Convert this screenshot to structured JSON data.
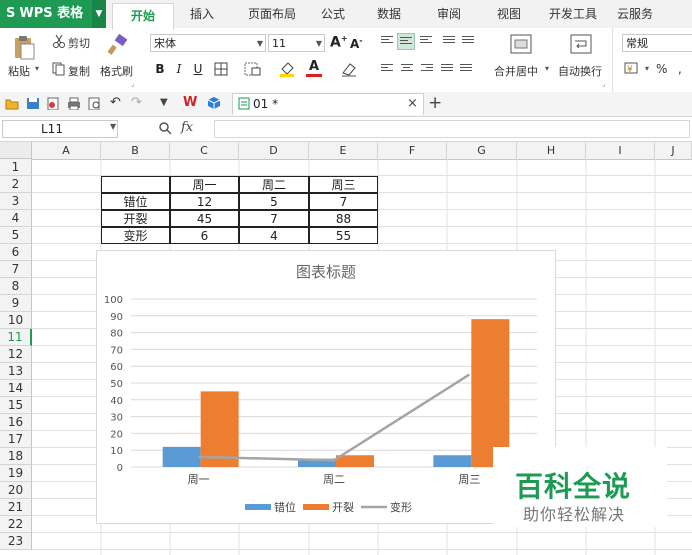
{
  "app": {
    "name": "WPS 表格"
  },
  "menu": {
    "tabs": [
      "开始",
      "插入",
      "页面布局",
      "公式",
      "数据",
      "审阅",
      "视图",
      "开发工具",
      "云服务"
    ],
    "active": "开始"
  },
  "ribbon": {
    "paste": "粘贴",
    "cut": "剪切",
    "copy": "复制",
    "format_painter": "格式刷",
    "font_name": "宋体",
    "font_size": "11",
    "bold": "B",
    "italic": "I",
    "underline": "U",
    "merge_center": "合并居中",
    "wrap_text": "自动换行",
    "number_format": "常规",
    "percent": "%"
  },
  "doc_tab": {
    "name": "01 *"
  },
  "formula_bar": {
    "name_box": "L11",
    "fx": "fx",
    "value": ""
  },
  "sheet": {
    "columns": [
      "A",
      "B",
      "C",
      "D",
      "E",
      "F",
      "G",
      "H",
      "I",
      "J"
    ],
    "rows": [
      "1",
      "2",
      "3",
      "4",
      "5",
      "6",
      "7",
      "8",
      "9",
      "10",
      "11",
      "12",
      "13",
      "14",
      "15",
      "16",
      "17",
      "18",
      "19",
      "20",
      "21",
      "22",
      "23"
    ],
    "selected_row": "11",
    "table": {
      "headers": [
        "",
        "周一",
        "周二",
        "周三"
      ],
      "rows": [
        [
          "错位",
          "12",
          "5",
          "7"
        ],
        [
          "开裂",
          "45",
          "7",
          "88"
        ],
        [
          "变形",
          "6",
          "4",
          "55"
        ]
      ]
    }
  },
  "chart_data": {
    "type": "bar",
    "title": "图表标题",
    "categories": [
      "周一",
      "周二",
      "周三"
    ],
    "series": [
      {
        "name": "错位",
        "type": "bar",
        "values": [
          12,
          5,
          7
        ],
        "color": "#5b9bd5"
      },
      {
        "name": "开裂",
        "type": "bar",
        "values": [
          45,
          7,
          88
        ],
        "color": "#ed7d31"
      },
      {
        "name": "变形",
        "type": "line",
        "values": [
          6,
          4,
          55
        ],
        "color": "#a5a5a5"
      }
    ],
    "ylim": [
      0,
      100
    ],
    "yticks": [
      "0",
      "10",
      "20",
      "30",
      "40",
      "50",
      "60",
      "70",
      "80",
      "90",
      "100"
    ],
    "grid": true,
    "legend": "bottom"
  },
  "watermark": {
    "title": "百科全说",
    "subtitle": "助你轻松解决",
    "color": "#1e9a53"
  }
}
